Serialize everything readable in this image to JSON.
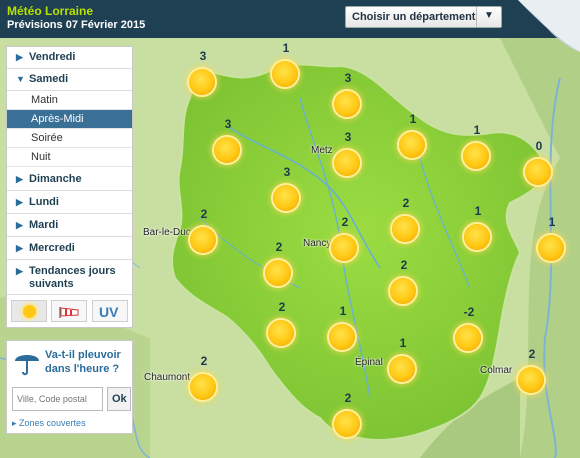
{
  "header": {
    "title": "Météo Lorraine",
    "subtitle": "Prévisions 07 Février 2015",
    "department_select": "Choisir un département"
  },
  "sidebar": {
    "days": [
      {
        "label": "Vendredi",
        "expanded": false
      },
      {
        "label": "Samedi",
        "expanded": true
      },
      {
        "label": "Dimanche",
        "expanded": false
      },
      {
        "label": "Lundi",
        "expanded": false
      },
      {
        "label": "Mardi",
        "expanded": false
      },
      {
        "label": "Mercredi",
        "expanded": false
      },
      {
        "label": "Tendances jours suivants",
        "expanded": false
      }
    ],
    "periods": [
      "Matin",
      "Après-Midi",
      "Soirée",
      "Nuit"
    ],
    "active_period": "Après-Midi",
    "modes": [
      "sun-icon",
      "wind-icon",
      "UV"
    ],
    "uv_label": "UV"
  },
  "rain_widget": {
    "question": "Va-t-il pleuvoir dans l'heure ?",
    "input_placeholder": "Ville, Code postal",
    "ok_label": "Ok",
    "zones_link": "Zones couvertes"
  },
  "map": {
    "cities": [
      "Metz",
      "Nancy",
      "Bar-le-Duc",
      "Épinal",
      "Chaumont",
      "Colmar"
    ],
    "markers": [
      {
        "value": "3",
        "icon": "sun-icon"
      },
      {
        "value": "1",
        "icon": "sun-icon"
      },
      {
        "value": "3",
        "icon": "sun-icon"
      },
      {
        "value": "3",
        "icon": "sun-icon"
      },
      {
        "value": "3",
        "icon": "sun-icon"
      },
      {
        "value": "1",
        "icon": "sun-icon"
      },
      {
        "value": "1",
        "icon": "sun-icon"
      },
      {
        "value": "0",
        "icon": "sun-icon"
      },
      {
        "value": "3",
        "icon": "sun-icon"
      },
      {
        "value": "2",
        "icon": "sun-icon"
      },
      {
        "value": "2",
        "icon": "sun-icon"
      },
      {
        "value": "2",
        "icon": "sun-icon"
      },
      {
        "value": "2",
        "icon": "sun-icon"
      },
      {
        "value": "1",
        "icon": "sun-icon"
      },
      {
        "value": "1",
        "icon": "sun-icon"
      },
      {
        "value": "2",
        "icon": "sun-icon"
      },
      {
        "value": "2",
        "icon": "sun-icon"
      },
      {
        "value": "1",
        "icon": "sun-icon"
      },
      {
        "value": "-2",
        "icon": "sun-icon"
      },
      {
        "value": "1",
        "icon": "sun-icon"
      },
      {
        "value": "2",
        "icon": "sun-icon"
      },
      {
        "value": "2",
        "icon": "sun-icon"
      },
      {
        "value": "2",
        "icon": "sun-icon"
      }
    ]
  },
  "colors": {
    "header_bg": "#1f3f52",
    "title_color": "#b7e200",
    "region_fill": "#8fd13c",
    "active_period_bg": "#3a6f96"
  }
}
